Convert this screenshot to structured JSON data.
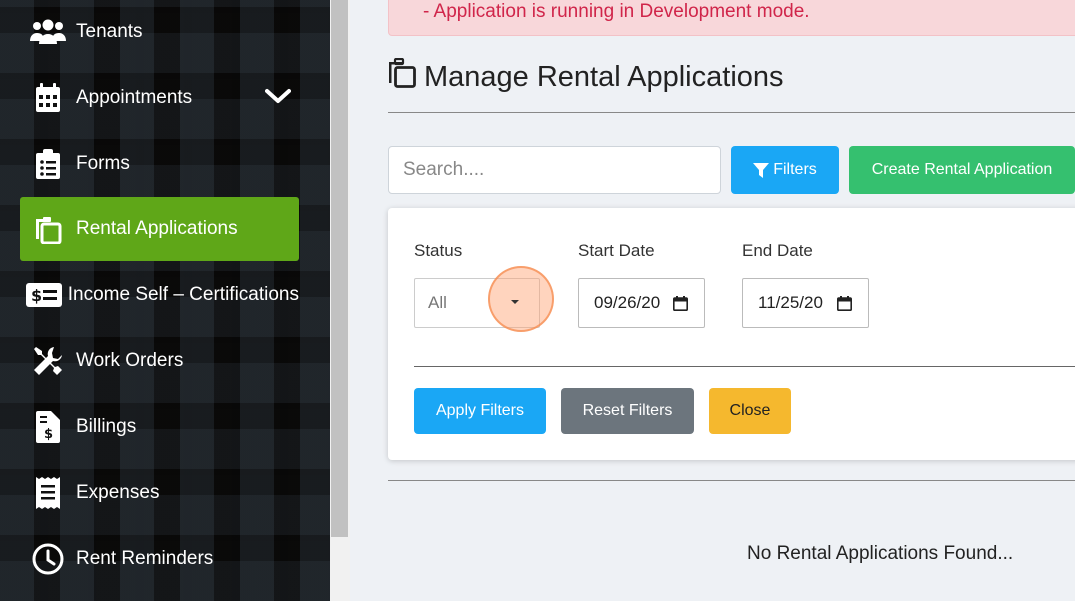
{
  "sidebar": {
    "items": [
      {
        "label": "Tenants",
        "icon": "users-icon"
      },
      {
        "label": "Appointments",
        "icon": "calendar-icon"
      },
      {
        "label": "Forms",
        "icon": "clipboard-list-icon"
      },
      {
        "label": "Rental Applications",
        "icon": "copy-icon",
        "active": true
      },
      {
        "label": "Income Self – Certifications",
        "icon": "money-check-icon"
      },
      {
        "label": "Work Orders",
        "icon": "tools-icon"
      },
      {
        "label": "Billings",
        "icon": "file-invoice-dollar-icon"
      },
      {
        "label": "Expenses",
        "icon": "receipt-icon"
      },
      {
        "label": "Rent Reminders",
        "icon": "clock-icon"
      }
    ]
  },
  "alert": {
    "text": "- Application is running in Development mode."
  },
  "page": {
    "title": "Manage Rental Applications"
  },
  "search": {
    "placeholder": "Search...."
  },
  "toolbar": {
    "filters_label": "Filters",
    "create_label": "Create Rental Application"
  },
  "filters": {
    "status_label": "Status",
    "status_value": "All",
    "start_label": "Start Date",
    "start_value": "09/26/20",
    "end_label": "End Date",
    "end_value": "11/25/20",
    "apply_label": "Apply Filters",
    "reset_label": "Reset Filters",
    "close_label": "Close"
  },
  "empty_message": "No Rental Applications Found...",
  "colors": {
    "active": "#5fa718",
    "primary": "#1aa7f5",
    "success": "#35c06f",
    "warning": "#f5b82e",
    "secondary": "#6c757d"
  }
}
